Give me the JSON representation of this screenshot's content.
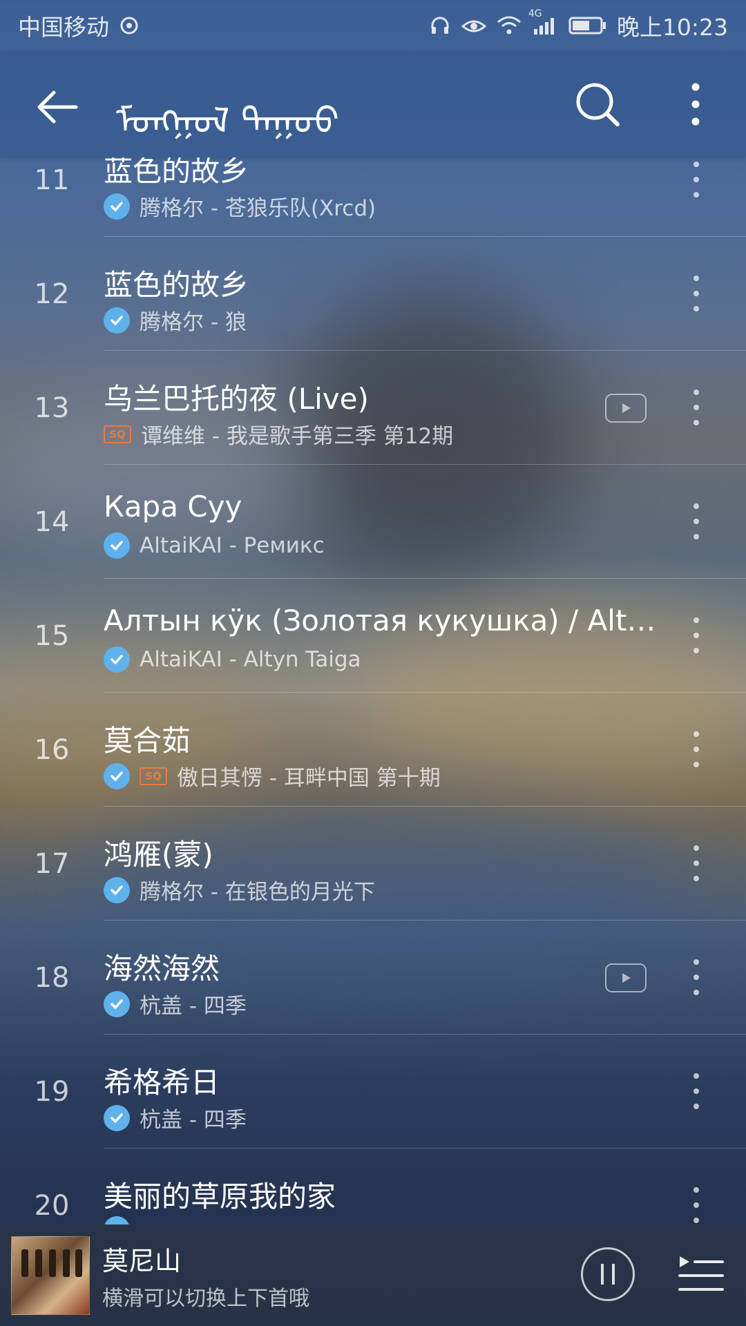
{
  "status_bar": {
    "carrier": "中国移动",
    "network": "4G",
    "time": "晚上10:23"
  },
  "header": {
    "title": "ᠮᠣᠩᠭᠣᠯ ᠳᠠᠭᠤᠤ"
  },
  "songs": [
    {
      "num": "11",
      "title": "蓝色的故乡",
      "subtitle": "腾格尔 - 苍狼乐队(Xrcd)",
      "downloaded": true,
      "sq": false,
      "mv": false
    },
    {
      "num": "12",
      "title": "蓝色的故乡",
      "subtitle": "腾格尔 - 狼",
      "downloaded": true,
      "sq": false,
      "mv": false
    },
    {
      "num": "13",
      "title": "乌兰巴托的夜 (Live)",
      "subtitle": "谭维维 - 我是歌手第三季 第12期",
      "downloaded": false,
      "sq": true,
      "mv": true
    },
    {
      "num": "14",
      "title": "Кара Суу",
      "subtitle": "AltaiKAI - Ремикс",
      "downloaded": true,
      "sq": false,
      "mv": false
    },
    {
      "num": "15",
      "title": "Алтын кӱк (Золотая кукушка) / Altyn...",
      "subtitle": "AltaiKAI - Altyn Taiga",
      "downloaded": true,
      "sq": false,
      "mv": false
    },
    {
      "num": "16",
      "title": "莫合茹",
      "subtitle": "傲日其愣 - 耳畔中国 第十期",
      "downloaded": true,
      "sq": true,
      "mv": false
    },
    {
      "num": "17",
      "title": "鸿雁(蒙)",
      "subtitle": "腾格尔 - 在银色的月光下",
      "downloaded": true,
      "sq": false,
      "mv": false
    },
    {
      "num": "18",
      "title": "海然海然",
      "subtitle": "杭盖 - 四季",
      "downloaded": true,
      "sq": false,
      "mv": true
    },
    {
      "num": "19",
      "title": "希格希日",
      "subtitle": "杭盖 - 四季",
      "downloaded": true,
      "sq": false,
      "mv": false
    },
    {
      "num": "20",
      "title": "美丽的草原我的家",
      "subtitle": "",
      "downloaded": true,
      "sq": false,
      "mv": false
    }
  ],
  "player": {
    "title": "莫尼山",
    "hint": "横滑可以切换上下首哦"
  },
  "icons": {
    "sq_label": "SQ"
  }
}
